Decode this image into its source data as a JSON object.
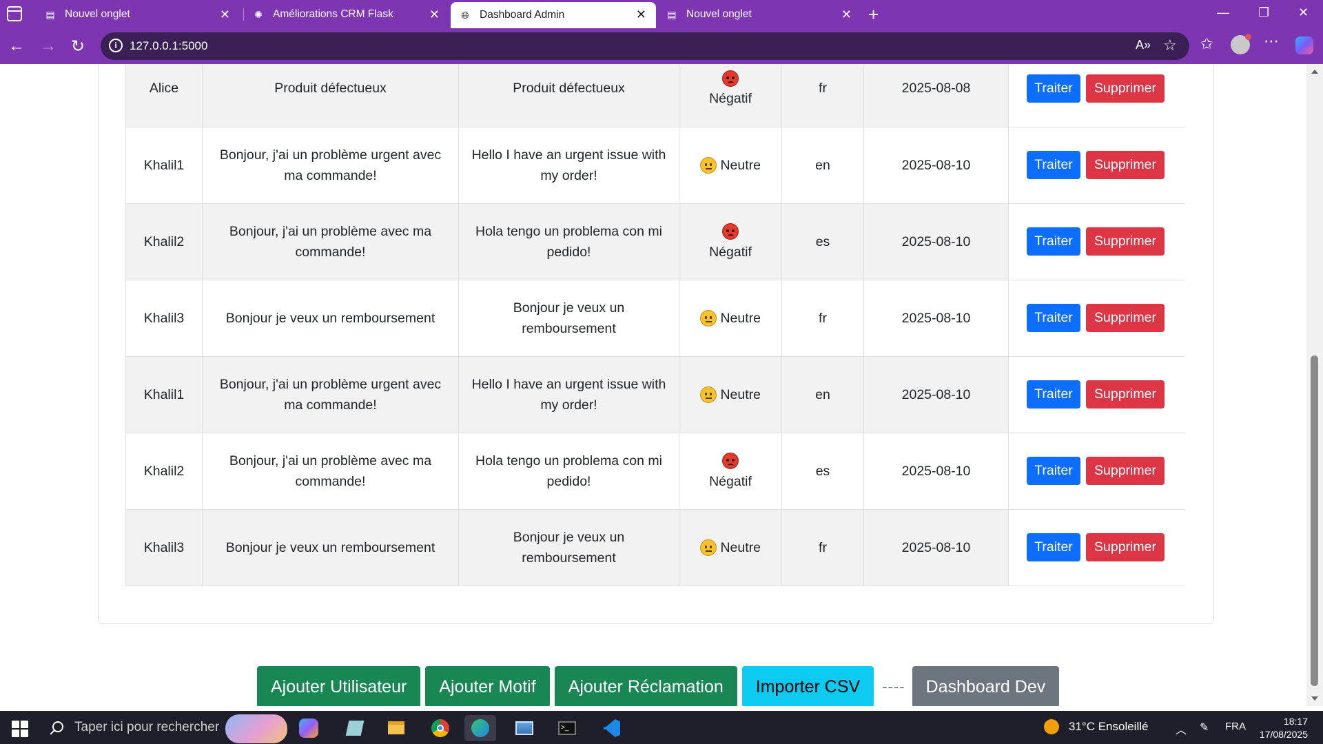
{
  "browser": {
    "tabs": [
      {
        "label": "Nouvel onglet"
      },
      {
        "label": "Améliorations CRM Flask"
      },
      {
        "label": "Dashboard Admin"
      },
      {
        "label": "Nouvel onglet"
      }
    ],
    "url": "127.0.0.1:5000"
  },
  "table": {
    "rows": [
      {
        "user": "Alice",
        "message": "Produit défectueux",
        "translation": "Produit défectueux",
        "sentiment": "Négatif",
        "sentiment_icon": "angry-face-icon",
        "lang": "fr",
        "date": "2025-08-08"
      },
      {
        "user": "Khalil1",
        "message": "Bonjour, j'ai un problème urgent avec ma commande!",
        "translation": "Hello I have an urgent issue with my order!",
        "sentiment": "Neutre",
        "sentiment_icon": "neutral-face-icon",
        "lang": "en",
        "date": "2025-08-10"
      },
      {
        "user": "Khalil2",
        "message": "Bonjour, j'ai un problème avec ma commande!",
        "translation": "Hola tengo un problema con mi pedido!",
        "sentiment": "Négatif",
        "sentiment_icon": "angry-face-icon",
        "lang": "es",
        "date": "2025-08-10"
      },
      {
        "user": "Khalil3",
        "message": "Bonjour je veux un remboursement",
        "translation": "Bonjour je veux un remboursement",
        "sentiment": "Neutre",
        "sentiment_icon": "neutral-face-icon",
        "lang": "fr",
        "date": "2025-08-10"
      },
      {
        "user": "Khalil1",
        "message": "Bonjour, j'ai un problème urgent avec ma commande!",
        "translation": "Hello I have an urgent issue with my order!",
        "sentiment": "Neutre",
        "sentiment_icon": "neutral-face-icon",
        "lang": "en",
        "date": "2025-08-10"
      },
      {
        "user": "Khalil2",
        "message": "Bonjour, j'ai un problème avec ma commande!",
        "translation": "Hola tengo un problema con mi pedido!",
        "sentiment": "Négatif",
        "sentiment_icon": "angry-face-icon",
        "lang": "es",
        "date": "2025-08-10"
      },
      {
        "user": "Khalil3",
        "message": "Bonjour je veux un remboursement",
        "translation": "Bonjour je veux un remboursement",
        "sentiment": "Neutre",
        "sentiment_icon": "neutral-face-icon",
        "lang": "fr",
        "date": "2025-08-10"
      }
    ],
    "actions": {
      "treat_label": "Traiter",
      "delete_label": "Supprimer"
    }
  },
  "actionbar": {
    "add_user": "Ajouter Utilisateur",
    "add_motif": "Ajouter Motif",
    "add_reclamation": "Ajouter Réclamation",
    "import_csv": "Importer CSV",
    "separator": "----",
    "dashboard_dev": "Dashboard Dev"
  },
  "taskbar": {
    "search_placeholder": "Taper ici pour rechercher",
    "weather": "31°C  Ensoleillé",
    "language": "FRA",
    "time": "18:17",
    "date": "17/08/2025"
  },
  "colors": {
    "browser_accent": "#7d35b2",
    "primary": "#0d6efd",
    "danger": "#dc3545",
    "success": "#198754",
    "info": "#0dcaf0",
    "secondary": "#6c757d"
  }
}
